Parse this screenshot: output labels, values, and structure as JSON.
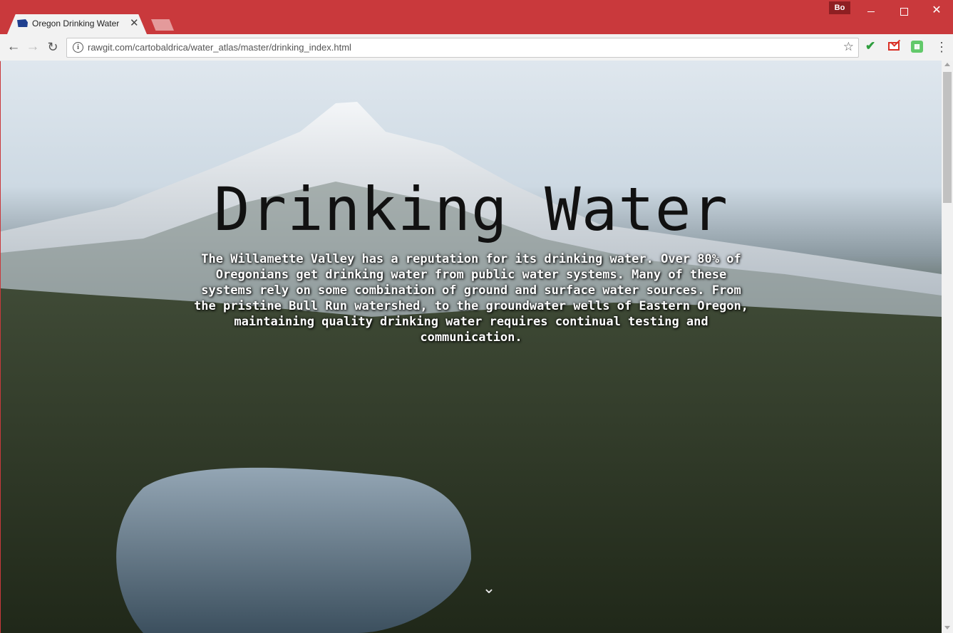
{
  "browser": {
    "tab_title": "Oregon Drinking Water",
    "tab_close": "✕",
    "profile_label": "Bo",
    "url": "rawgit.com/cartobaldrica/water_atlas/master/drinking_index.html",
    "icons": {
      "favicon": "oregon-flag-icon",
      "back": "back-arrow-icon",
      "forward": "forward-arrow-icon",
      "reload": "reload-icon",
      "info": "info-icon",
      "star": "star-icon",
      "extensions": [
        "checkmark-extension-icon",
        "gmail-extension-icon",
        "green-extension-icon"
      ],
      "menu": "kebab-menu-icon"
    },
    "accent_color": "#c9393c"
  },
  "page": {
    "title": "Drinking Water",
    "intro": "The Willamette Valley has a reputation for its drinking water. Over 80% of Oregonians get drinking water from public water systems. Many of these systems rely on some combination of ground and surface water sources. From the pristine Bull Run watershed, to the groundwater wells of Eastern Oregon, maintaining quality drinking water requires continual testing and communication.",
    "scroll_hint_icon": "chevron-down-icon"
  }
}
